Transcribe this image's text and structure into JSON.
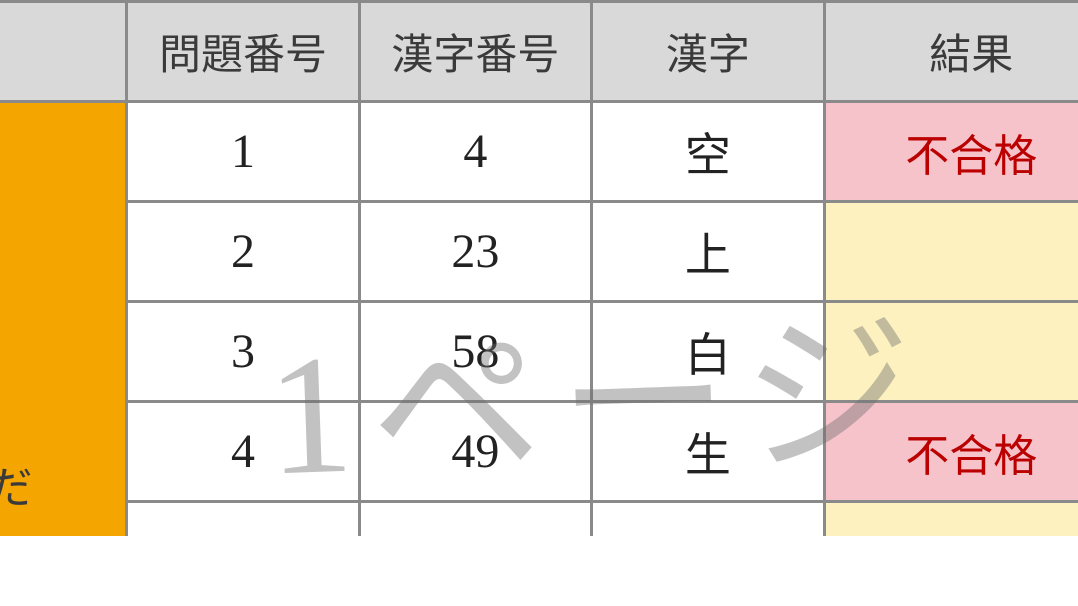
{
  "headers": {
    "side": "",
    "question_no": "問題番号",
    "kanji_no": "漢字番号",
    "kanji": "漢字",
    "result": "結果"
  },
  "side_label": "zだ",
  "rows": [
    {
      "q": "1",
      "k": "4",
      "ch": "空",
      "res": "不合格",
      "res_kind": "fail"
    },
    {
      "q": "2",
      "k": "23",
      "ch": "上",
      "res": "",
      "res_kind": "warn"
    },
    {
      "q": "3",
      "k": "58",
      "ch": "白",
      "res": "",
      "res_kind": "warn"
    },
    {
      "q": "4",
      "k": "49",
      "ch": "生",
      "res": "不合格",
      "res_kind": "fail"
    }
  ],
  "watermark": "1ページ"
}
